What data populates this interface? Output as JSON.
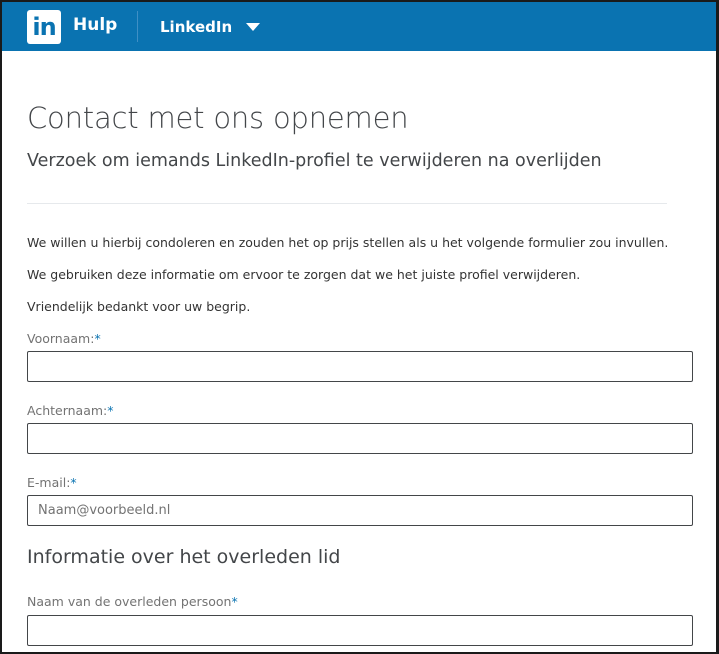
{
  "header": {
    "logo_text": "in",
    "title": "Hulp",
    "product": "LinkedIn"
  },
  "page": {
    "title": "Contact met ons opnemen",
    "subtitle": "Verzoek om iemands LinkedIn-profiel te verwijderen na overlijden",
    "paragraphs": [
      "We willen u hierbij condoleren en zouden het op prijs stellen als u het volgende formulier zou invullen.",
      "We gebruiken deze informatie om ervoor te zorgen dat we het juiste profiel verwijderen.",
      "Vriendelijk bedankt voor uw begrip."
    ]
  },
  "form": {
    "required_marker": "*",
    "first_name": {
      "label": "Voornaam:",
      "value": "",
      "placeholder": ""
    },
    "last_name": {
      "label": "Achternaam:",
      "value": "",
      "placeholder": ""
    },
    "email": {
      "label": "E-mail:",
      "value": "",
      "placeholder": "Naam@voorbeeld.nl"
    },
    "section_heading": "Informatie over het overleden lid",
    "deceased_name": {
      "label": "Naam van de overleden persoon",
      "value": "",
      "placeholder": ""
    }
  },
  "colors": {
    "brand": "#0a73b1",
    "text": "#333333",
    "muted": "#737373"
  }
}
